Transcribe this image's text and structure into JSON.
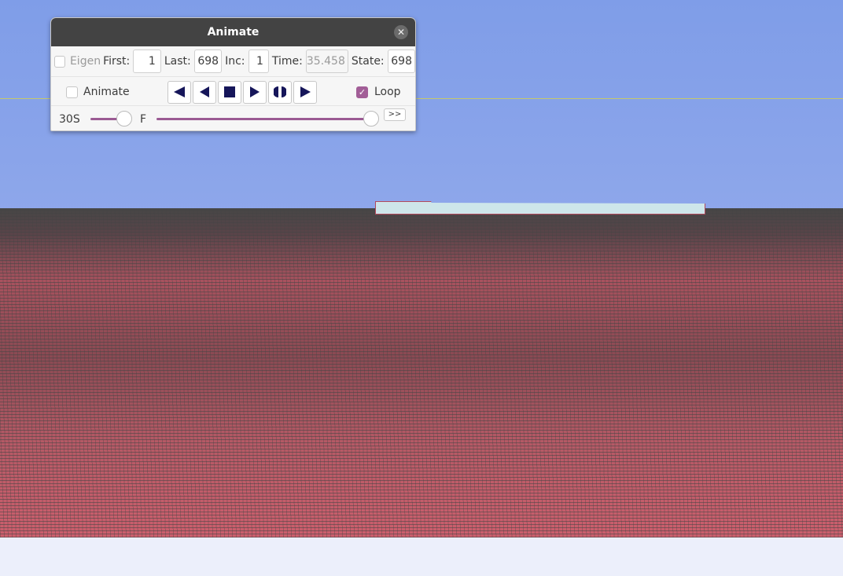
{
  "dialog": {
    "title": "Animate",
    "eigen_label": "Eigen",
    "eigen_checked": false,
    "first_label": "First:",
    "first_value": "1",
    "last_label": "Last:",
    "last_value": "698",
    "inc_label": "Inc:",
    "inc_value": "1",
    "time_label": "Time:",
    "time_value": "35.458",
    "state_label": "State:",
    "state_value": "698",
    "animate_label": "Animate",
    "animate_checked": false,
    "loop_label": "Loop",
    "loop_checked": true,
    "speed_slow_label": "30S",
    "speed_fast_label": "F",
    "speed_fraction": 0.85,
    "frame_fraction": 1.0,
    "more_button": ">>",
    "accent": "#9b5a93"
  },
  "colors": {
    "terrain": "#cc5f6d",
    "sky_top": "#7f9de8",
    "sky_bottom": "#a5b6ef"
  }
}
